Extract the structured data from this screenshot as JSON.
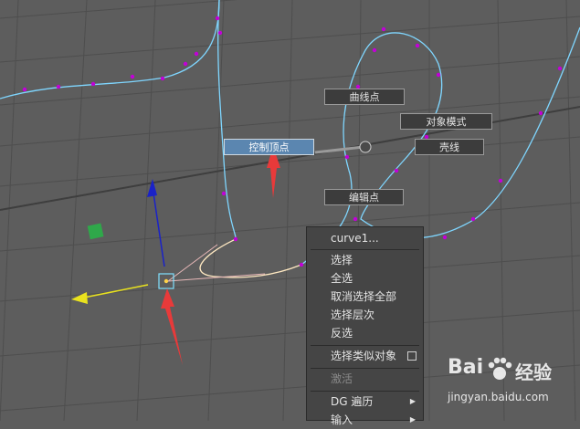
{
  "marking_menu": {
    "curve_point": "曲线点",
    "object_mode": "对象模式",
    "control_vertex": "控制顶点",
    "hull": "壳线",
    "edit_point": "编辑点"
  },
  "context_menu": {
    "title": "curve1...",
    "items": {
      "select": "选择",
      "select_all": "全选",
      "deselect_all": "取消选择全部",
      "select_hierarchy": "选择层次",
      "invert": "反选",
      "select_similar": "选择类似对象",
      "activate": "激活",
      "dg_traversal": "DG 遍历",
      "input": "输入"
    }
  },
  "watermark": {
    "brand_left": "Bai",
    "brand_right": "经验",
    "url": "jingyan.baidu.com"
  },
  "colors": {
    "viewport_bg": "#5d5d5d",
    "grid": "#4f4f4f",
    "curve": "#7fd6ff",
    "cv_point": "#c200d8",
    "active_item": "#5b86b0",
    "annotation_arrow": "#e83a3a"
  }
}
